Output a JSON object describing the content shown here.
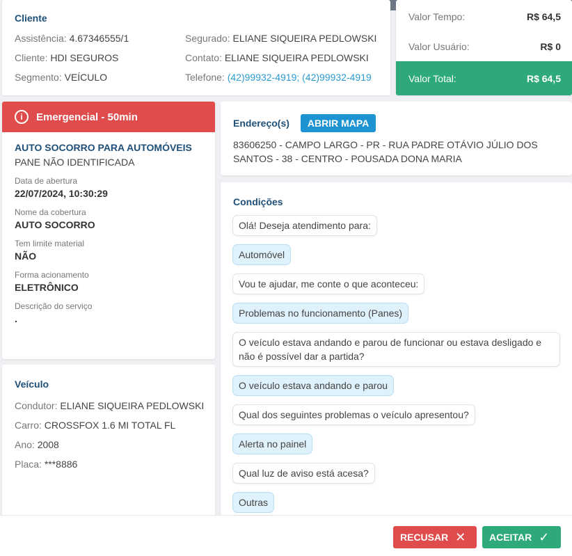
{
  "cliente": {
    "title": "Cliente",
    "assistencia_label": "Assistência:",
    "assistencia_value": "4.67346555/1",
    "cliente_label": "Cliente:",
    "cliente_value": "HDI SEGUROS",
    "segmento_label": "Segmento:",
    "segmento_value": "VEÍCULO",
    "segurado_label": "Segurado:",
    "segurado_value": "ELIANE SIQUEIRA PEDLOWSKI",
    "contato_label": "Contato:",
    "contato_value": "ELIANE SIQUEIRA PEDLOWSKI",
    "telefone_label": "Telefone:",
    "telefone_value": "(42)99932-4919; (42)99932-4919"
  },
  "valores": {
    "tempo_label": "Valor Tempo:",
    "tempo_value": "R$ 64,5",
    "usuario_label": "Valor Usuário:",
    "usuario_value": "R$ 0",
    "total_label": "Valor Total:",
    "total_value": "R$ 64,5"
  },
  "detalhes": {
    "banner_icon": "i",
    "banner": "Emergencial - 50min",
    "servico_title": "AUTO SOCORRO PARA AUTOMÓVEIS",
    "servico_sub": "PANE NÃO IDENTIFICADA",
    "fields": [
      {
        "label": "Data de abertura",
        "value": "22/07/2024, 10:30:29"
      },
      {
        "label": "Nome da cobertura",
        "value": "AUTO SOCORRO"
      },
      {
        "label": "Tem limite material",
        "value": "NÃO"
      },
      {
        "label": "Forma acionamento",
        "value": "ELETRÔNICO"
      },
      {
        "label": "Descrição do serviço",
        "value": "."
      }
    ]
  },
  "veiculo": {
    "title": "Veículo",
    "condutor_label": "Condutor:",
    "condutor_value": "ELIANE SIQUEIRA PEDLOWSKI",
    "carro_label": "Carro:",
    "carro_value": "CROSSFOX 1.6 MI TOTAL FL",
    "ano_label": "Ano:",
    "ano_value": "2008",
    "placa_label": "Placa:",
    "placa_value": "***8886"
  },
  "endereco": {
    "title": "Endereço(s)",
    "mapa_button": "ABRIR MAPA",
    "text": "83606250 - CAMPO LARGO - PR - RUA PADRE OTÁVIO JÚLIO DOS SANTOS - 38 - CENTRO - POUSADA DONA MARIA"
  },
  "condicoes": {
    "title": "Condições",
    "messages": [
      {
        "type": "q",
        "text": "Olá! Deseja atendimento para:"
      },
      {
        "type": "a",
        "text": "Automóvel"
      },
      {
        "type": "q",
        "text": "Vou te ajudar, me conte o que aconteceu:"
      },
      {
        "type": "a",
        "text": "Problemas no funcionamento (Panes)"
      },
      {
        "type": "q",
        "text": "O veículo estava andando e parou de funcionar ou estava desligado e não é possível dar a partida?"
      },
      {
        "type": "a",
        "text": "O veículo estava andando e parou"
      },
      {
        "type": "q",
        "text": "Qual dos seguintes problemas o veículo apresentou?"
      },
      {
        "type": "a",
        "text": "Alerta no painel"
      },
      {
        "type": "q",
        "text": "Qual luz de aviso está acesa?"
      },
      {
        "type": "a",
        "text": "Outras"
      }
    ]
  },
  "footer": {
    "recusar": "RECUSAR",
    "recusar_icon": "✕",
    "aceitar": "ACEITAR",
    "aceitar_icon": "✓"
  },
  "colors": {
    "primary_title": "#1e4f78",
    "danger": "#e04c4c",
    "success": "#2eaa7a",
    "info": "#1e93d3"
  }
}
